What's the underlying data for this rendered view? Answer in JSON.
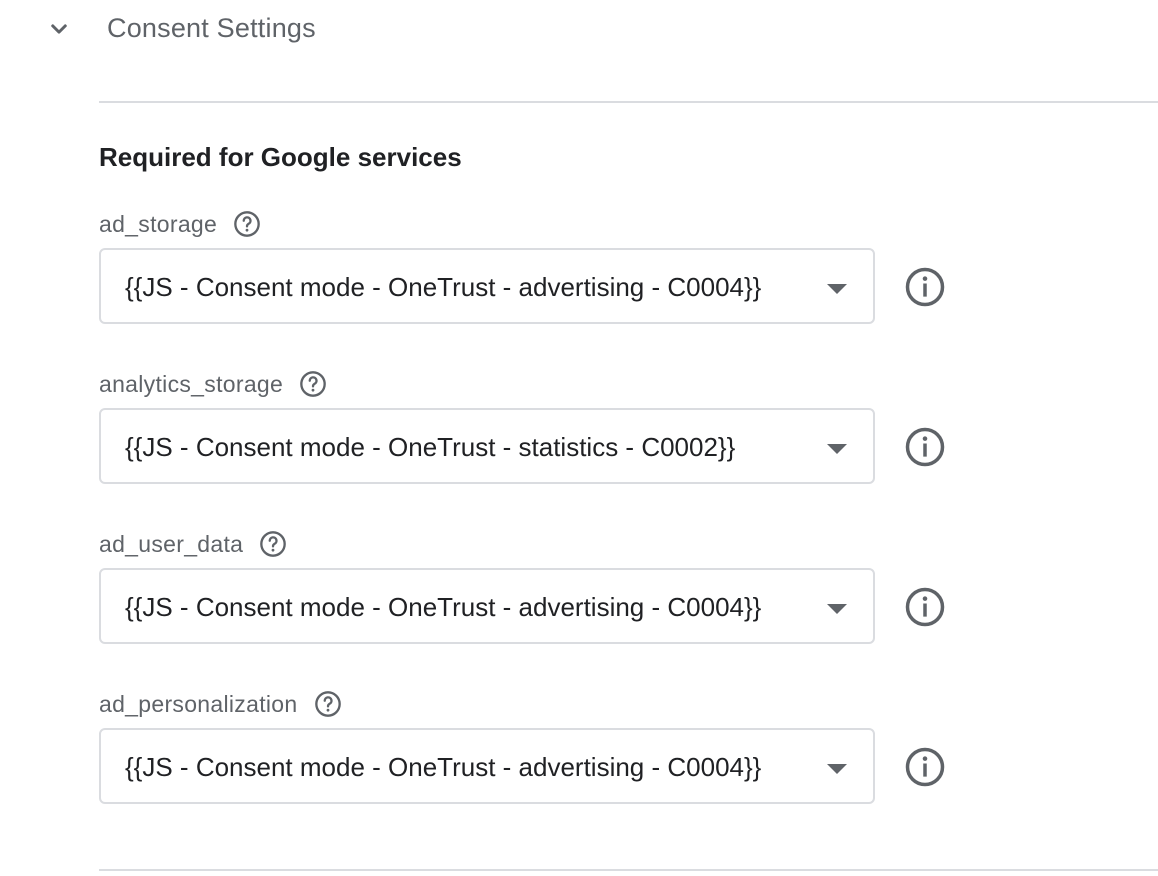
{
  "section": {
    "title": "Consent Settings",
    "expanded": true
  },
  "group": {
    "title": "Required for Google services"
  },
  "fields": [
    {
      "label": "ad_storage",
      "value": "{{JS - Consent mode - OneTrust - advertising - C0004}}"
    },
    {
      "label": "analytics_storage",
      "value": "{{JS - Consent mode - OneTrust - statistics - C0002}}"
    },
    {
      "label": "ad_user_data",
      "value": "{{JS - Consent mode - OneTrust - advertising - C0004}}"
    },
    {
      "label": "ad_personalization",
      "value": "{{JS - Consent mode - OneTrust - advertising - C0004}}"
    }
  ],
  "icons": {
    "collapse": "chevron-down-icon",
    "help": "help-circle-icon",
    "info": "info-circle-icon",
    "dropdown": "dropdown-arrow-icon"
  },
  "colors": {
    "title_gray": "#5f6368",
    "text_dark": "#202124",
    "border": "#dadce0",
    "icon_gray": "#5f6368"
  }
}
